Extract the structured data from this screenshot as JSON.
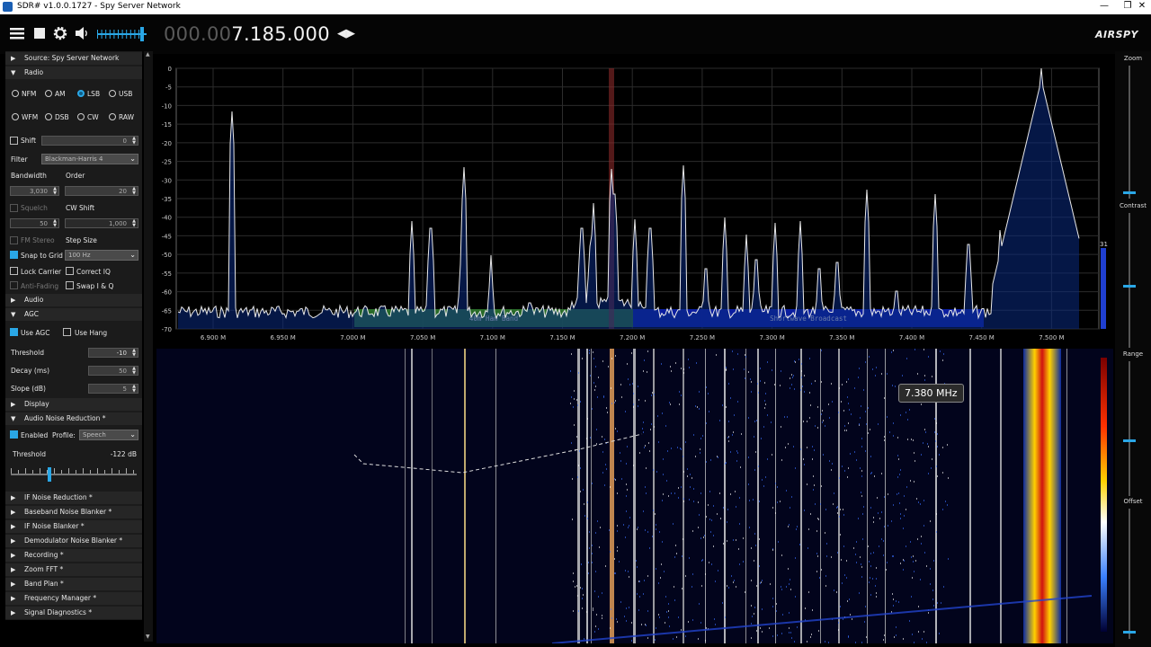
{
  "window": {
    "title": "SDR# v1.0.0.1727 - Spy Server Network",
    "minimize": "—",
    "restore": "❐",
    "close": "✕"
  },
  "toolbar": {
    "freq_dim": "000.00",
    "freq_bright": "7.185.000",
    "freq_arrows": "◀▶",
    "logo": "AIRSPY",
    "volume_level": 0.95
  },
  "sidebar": {
    "source_label": "Source: Spy Server Network",
    "radio_label": "Radio",
    "modes": [
      "NFM",
      "AM",
      "LSB",
      "USB",
      "WFM",
      "DSB",
      "CW",
      "RAW"
    ],
    "selected_mode": "LSB",
    "shift_label": "Shift",
    "shift_value": "0",
    "filter_label": "Filter",
    "filter_value": "Blackman-Harris 4",
    "bandwidth_label": "Bandwidth",
    "bandwidth_value": "3,030",
    "order_label": "Order",
    "order_value": "20",
    "squelch_label": "Squelch",
    "squelch_value": "50",
    "cw_shift_label": "CW Shift",
    "cw_shift_value": "1,000",
    "fm_stereo_label": "FM Stereo",
    "step_size_label": "Step Size",
    "snap_label": "Snap to Grid",
    "step_value": "100 Hz",
    "lock_carrier_label": "Lock Carrier",
    "correct_iq_label": "Correct IQ",
    "anti_fading_label": "Anti-Fading",
    "swap_iq_label": "Swap I & Q",
    "audio_label": "Audio",
    "agc_label": "AGC",
    "use_agc_label": "Use AGC",
    "use_hang_label": "Use Hang",
    "threshold_label": "Threshold",
    "threshold_value": "-10",
    "decay_label": "Decay (ms)",
    "decay_value": "50",
    "slope_label": "Slope (dB)",
    "slope_value": "5",
    "display_label": "Display",
    "anr_label": "Audio Noise Reduction *",
    "enabled_label": "Enabled",
    "profile_label": "Profile:",
    "profile_value": "Speech",
    "anr_threshold_label": "Threshold",
    "anr_threshold_value": "-122 dB",
    "anr_threshold_level": 0.3,
    "plugins": [
      "IF Noise Reduction *",
      "Baseband Noise Blanker *",
      "IF Noise Blanker *",
      "Demodulator Noise Blanker *",
      "Recording *",
      "Zoom FFT *",
      "Band Plan *",
      "Frequency Manager *",
      "Signal Diagnostics *"
    ]
  },
  "spectrum": {
    "y_ticks": [
      "0",
      "-5",
      "-10",
      "-15",
      "-20",
      "-25",
      "-30",
      "-35",
      "-40",
      "-45",
      "-50",
      "-55",
      "-60",
      "-65",
      "-70"
    ],
    "x_ticks": [
      "6.900 M",
      "6.950 M",
      "7.000 M",
      "7.050 M",
      "7.100 M",
      "7.150 M",
      "7.200 M",
      "7.250 M",
      "7.300 M",
      "7.350 M",
      "7.400 M",
      "7.450 M",
      "7.500 M"
    ],
    "bands": [
      {
        "label": "40m Ham Band",
        "color": "#2f7d2f"
      },
      {
        "label": "Shortwave Broadcast",
        "color": "#0b1fa8"
      }
    ],
    "side_value": "31"
  },
  "waterfall": {
    "tooltip": "7.380 MHz"
  },
  "right_panel": {
    "zoom_label": "Zoom",
    "contrast_label": "Contrast",
    "range_label": "Range",
    "offset_label": "Offset"
  }
}
